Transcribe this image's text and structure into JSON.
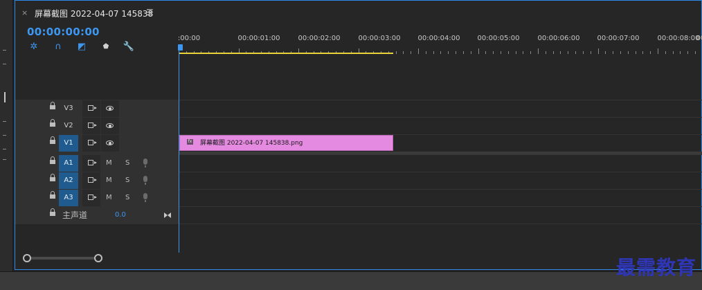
{
  "panel": {
    "close_glyph": "×",
    "title": "屏幕截图 2022-04-07 145838",
    "menu_glyph": "☰"
  },
  "timecode": "00:00:00:00",
  "tools": [
    {
      "name": "snap-icon",
      "glyph": "✲",
      "color": "#3d97f0"
    },
    {
      "name": "linked-selection-icon",
      "glyph": "∩",
      "color": "#3d97f0"
    },
    {
      "name": "add-marker-icon",
      "glyph": "◩",
      "color": "#3d97f0"
    },
    {
      "name": "marker-icon",
      "glyph": "⬟",
      "color": "#cfcfcf"
    },
    {
      "name": "wrench-icon",
      "glyph": "🔧",
      "color": "#cfcfcf"
    }
  ],
  "ruler": {
    "labels": [
      ":00:00",
      "00:00:01:00",
      "00:00:02:00",
      "00:00:03:00",
      "00:00:04:00",
      "00:00:05:00",
      "00:00:06:00",
      "00:00:07:00",
      "00:00:08:00",
      "00"
    ]
  },
  "tracks": {
    "video": [
      {
        "label": "V3",
        "active": false
      },
      {
        "label": "V2",
        "active": false
      },
      {
        "label": "V1",
        "active": true
      }
    ],
    "audio": [
      {
        "label": "A1",
        "mute": "M",
        "solo": "S"
      },
      {
        "label": "A2",
        "mute": "M",
        "solo": "S"
      },
      {
        "label": "A3",
        "mute": "M",
        "solo": "S"
      }
    ],
    "master": {
      "label": "主声道",
      "value": "0.0"
    }
  },
  "clip": {
    "fx_badge": "fx",
    "name": "屏幕截图 2022-04-07  145838.png",
    "color": "#e48ae0"
  },
  "watermark": "最需教育"
}
